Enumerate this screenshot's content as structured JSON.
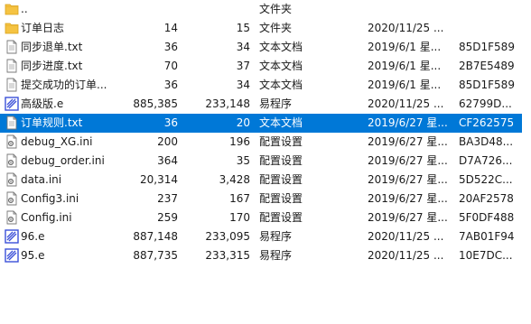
{
  "rows": [
    {
      "name": "..",
      "size": "",
      "packed": "",
      "type": "文件夹",
      "date": "",
      "crc": "",
      "icon": "folder-icon",
      "selected": false
    },
    {
      "name": "订单日志",
      "size": "14",
      "packed": "15",
      "type": "文件夹",
      "date": "2020/11/25 ...",
      "crc": "",
      "icon": "folder-icon",
      "selected": false
    },
    {
      "name": "同步退单.txt",
      "size": "36",
      "packed": "34",
      "type": "文本文档",
      "date": "2019/6/1 星...",
      "crc": "85D1F589",
      "icon": "text-file-icon",
      "selected": false
    },
    {
      "name": "同步进度.txt",
      "size": "70",
      "packed": "37",
      "type": "文本文档",
      "date": "2019/6/1 星...",
      "crc": "2B7E5489",
      "icon": "text-file-icon",
      "selected": false
    },
    {
      "name": "提交成功的订单...",
      "size": "36",
      "packed": "34",
      "type": "文本文档",
      "date": "2019/6/1 星...",
      "crc": "85D1F589",
      "icon": "text-file-icon",
      "selected": false
    },
    {
      "name": "高级版.e",
      "size": "885,385",
      "packed": "233,148",
      "type": "易程序",
      "date": "2020/11/25 ...",
      "crc": "62799D...",
      "icon": "e-program-icon",
      "selected": false
    },
    {
      "name": "订单规则.txt",
      "size": "36",
      "packed": "20",
      "type": "文本文档",
      "date": "2019/6/27 星...",
      "crc": "CF262575",
      "icon": "text-file-icon",
      "selected": true
    },
    {
      "name": "debug_XG.ini",
      "size": "200",
      "packed": "196",
      "type": "配置设置",
      "date": "2019/6/27 星...",
      "crc": "BA3D48...",
      "icon": "ini-file-icon",
      "selected": false
    },
    {
      "name": "debug_order.ini",
      "size": "364",
      "packed": "35",
      "type": "配置设置",
      "date": "2019/6/27 星...",
      "crc": "D7A726...",
      "icon": "ini-file-icon",
      "selected": false
    },
    {
      "name": "data.ini",
      "size": "20,314",
      "packed": "3,428",
      "type": "配置设置",
      "date": "2019/6/27 星...",
      "crc": "5D522C...",
      "icon": "ini-file-icon",
      "selected": false
    },
    {
      "name": "Config3.ini",
      "size": "237",
      "packed": "167",
      "type": "配置设置",
      "date": "2019/6/27 星...",
      "crc": "20AF2578",
      "icon": "ini-file-icon",
      "selected": false
    },
    {
      "name": "Config.ini",
      "size": "259",
      "packed": "170",
      "type": "配置设置",
      "date": "2019/6/27 星...",
      "crc": "5F0DF488",
      "icon": "ini-file-icon",
      "selected": false
    },
    {
      "name": "96.e",
      "size": "887,148",
      "packed": "233,095",
      "type": "易程序",
      "date": "2020/11/25 ...",
      "crc": "7AB01F94",
      "icon": "e-program-icon",
      "selected": false
    },
    {
      "name": "95.e",
      "size": "887,735",
      "packed": "233,315",
      "type": "易程序",
      "date": "2020/11/25 ...",
      "crc": "10E7DC...",
      "icon": "e-program-icon",
      "selected": false
    }
  ],
  "colors": {
    "selection": "#0078d7",
    "folder": "#f5c342",
    "e_icon": "#3a4fd8"
  }
}
